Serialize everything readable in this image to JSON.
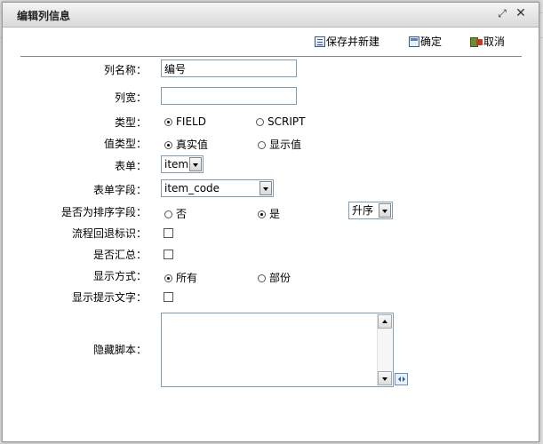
{
  "dialog": {
    "title": "编辑列信息",
    "maximize_glyph": "⤢",
    "close_glyph": "✕"
  },
  "toolbar": {
    "save_new_label": "保存并新建",
    "ok_label": "确定",
    "cancel_label": "取消"
  },
  "fields": {
    "column_name": {
      "label": "列名称：",
      "value": "编号"
    },
    "column_width": {
      "label": "列宽：",
      "value": ""
    },
    "type": {
      "label": "类型：",
      "options": [
        "FIELD",
        "SCRIPT"
      ],
      "selected": "FIELD"
    },
    "value_type": {
      "label": "值类型：",
      "options": [
        "真实值",
        "显示值"
      ],
      "selected": "真实值"
    },
    "form": {
      "label": "表单：",
      "value": "item"
    },
    "form_field": {
      "label": "表单字段：",
      "value": "item_code"
    },
    "sort_field": {
      "label": "是否为排序字段：",
      "options": [
        "否",
        "是"
      ],
      "selected": "是",
      "order_value": "升序"
    },
    "flow_back": {
      "label": "流程回退标识：",
      "checked": false
    },
    "summary": {
      "label": "是否汇总：",
      "checked": false
    },
    "display_mode": {
      "label": "显示方式：",
      "options": [
        "所有",
        "部份"
      ],
      "selected": "所有"
    },
    "show_tip": {
      "label": "显示提示文字：",
      "checked": false
    },
    "hidden_script": {
      "label": "隐藏脚本：",
      "value": ""
    }
  },
  "icons": {
    "save_new": "save-icon",
    "ok": "confirm-icon",
    "cancel": "cancel-icon",
    "expand": "expand-icon"
  }
}
